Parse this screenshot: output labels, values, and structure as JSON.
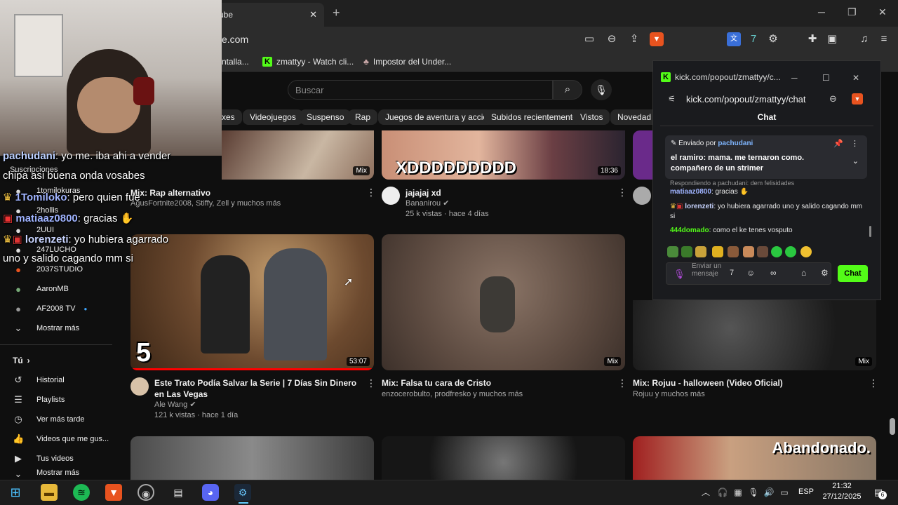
{
  "browser": {
    "tab_title": "ube",
    "url": "e.com",
    "bookmarks": [
      {
        "label": "ntalla..."
      },
      {
        "label": "zmattyy - Watch cli..."
      },
      {
        "label": "Impostor del Under..."
      }
    ]
  },
  "youtube": {
    "search_placeholder": "Buscar",
    "chips": [
      "xes",
      "Videojuegos",
      "Suspenso",
      "Rap",
      "Juegos de aventura y acción",
      "Subidos recientemente",
      "Vistos",
      "Novedad pa"
    ],
    "sidebar": {
      "subscriptions_label": "Suscripciones",
      "channels": [
        "1tomilokuras",
        "2hollis",
        "2UUI",
        "247LUCHO",
        "2037STUDIO",
        "AaronMB",
        "AF2008 TV"
      ],
      "show_more": "Mostrar más",
      "you_label": "Tú",
      "you_items": [
        "Historial",
        "Playlists",
        "Ver más tarde",
        "Videos que me gus...",
        "Tus videos",
        "Mostrar más"
      ]
    },
    "row1": [
      {
        "title": "Mix: Rap alternativo",
        "meta1": "AgusFortnite2008, Stiffy, Zell y muchos más",
        "badge": "Mix"
      },
      {
        "title": "jajajaj xd",
        "channel": "Bananirou",
        "meta2": "25 k vistas · hace 4 días",
        "thumb_text": "XDDDDDDDDD",
        "duration": "18:36"
      }
    ],
    "row2": [
      {
        "title": "Este Trato Podía Salvar la Serie | 7 Días Sin Dinero en Las Vegas",
        "channel": "Ale Wang",
        "meta2": "121 k vistas · hace 1 día",
        "duration": "53:07",
        "thumb_text": "5"
      },
      {
        "title": "Mix: Falsa tu cara de Cristo",
        "meta1": "enzocerobulto, prodfresko y muchos más",
        "badge": "Mix"
      },
      {
        "title": "Mix: Rojuu - halloween (Video Oficial)",
        "meta1": "Rojuu y muchos más",
        "badge": "Mix"
      }
    ],
    "row3_overlay_text": "Abandonado."
  },
  "stream_overlay": {
    "lines": [
      {
        "user": "pachudani",
        "text": ": yo me. iba ahi a vender"
      },
      {
        "user": "",
        "text": "chipa asi buena onda vosabes"
      },
      {
        "user": "1Tomiloko",
        "text": ": pero quien fue"
      },
      {
        "user": "matiaaz0800",
        "text": ": gracias"
      },
      {
        "user": "lorenzeti",
        "text": ": yo hubiera agarrado"
      },
      {
        "user": "",
        "text": "uno y salido cagando mm si"
      }
    ]
  },
  "kick_popout": {
    "window_title": "kick.com/popout/zmattyy/c...",
    "url": "kick.com/popout/zmattyy/chat",
    "header": "Chat",
    "pinned_by": "Enviado por",
    "pinned_user": "pachudani",
    "pinned_text": "el ramiro: mama. me ternaron como. compañero de un strimer",
    "reply_to": "Respondiendo a pachudani: dem felisidades",
    "messages": [
      {
        "user": "matiaaz0800",
        "text": ": gracias"
      },
      {
        "user": "lorenzeti",
        "text": ": yo hubiera agarrado uno y salido cagando mm si"
      },
      {
        "user": "444domado",
        "text": ": como el ke tenes vosputo"
      }
    ],
    "input_placeholder": "Enviar un mensaje",
    "chat_button": "Chat",
    "colors": {
      "accent": "#53fc18"
    }
  },
  "taskbar": {
    "lang": "ESP",
    "time": "21:32",
    "date": "27/12/2025",
    "notifications": "6"
  }
}
